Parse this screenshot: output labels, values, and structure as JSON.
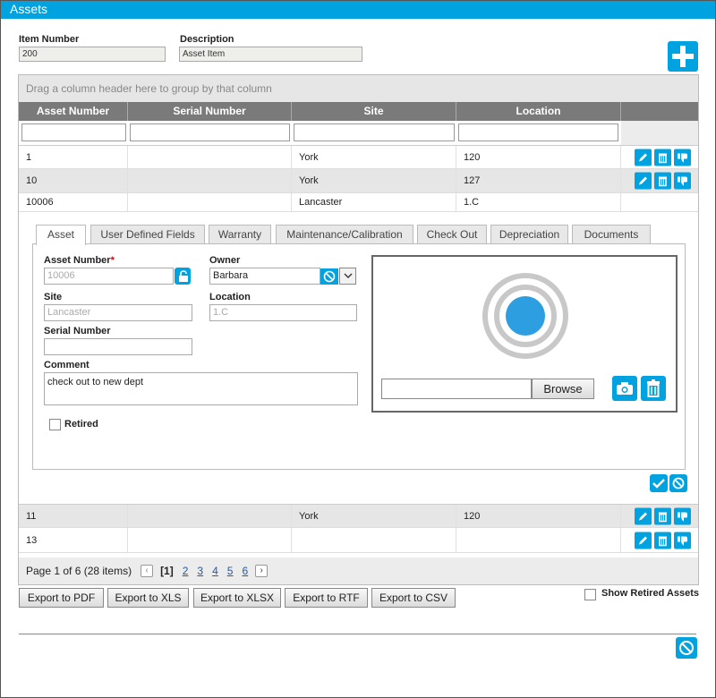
{
  "window": {
    "title": "Assets"
  },
  "item": {
    "item_number_label": "Item Number",
    "item_number_value": "200",
    "description_label": "Description",
    "description_value": "Asset Item"
  },
  "grid": {
    "group_hint": "Drag a column header here to group by that column",
    "columns": [
      "Asset Number",
      "Serial Number",
      "Site",
      "Location"
    ],
    "rows_top": [
      {
        "asset": "1",
        "serial": "",
        "site": "York",
        "location": "120"
      },
      {
        "asset": "10",
        "serial": "",
        "site": "York",
        "location": "127"
      },
      {
        "asset": "10006",
        "serial": "",
        "site": "Lancaster",
        "location": "1.C"
      }
    ],
    "rows_bottom": [
      {
        "asset": "11",
        "serial": "",
        "site": "York",
        "location": "120"
      },
      {
        "asset": "13",
        "serial": "",
        "site": "",
        "location": ""
      }
    ]
  },
  "tabs": [
    "Asset",
    "User Defined Fields",
    "Warranty",
    "Maintenance/Calibration",
    "Check Out",
    "Depreciation",
    "Documents"
  ],
  "form": {
    "asset_number_label": "Asset Number",
    "required_mark": "*",
    "asset_number_value": "10006",
    "owner_label": "Owner",
    "owner_value": "Barbara",
    "site_label": "Site",
    "site_value": "Lancaster",
    "location_label": "Location",
    "location_value": "1.C",
    "serial_label": "Serial Number",
    "serial_value": "",
    "comment_label": "Comment",
    "comment_value": "check out to new dept",
    "retired_label": "Retired",
    "browse_label": "Browse"
  },
  "pager": {
    "summary": "Page 1 of 6 (28 items)",
    "current": "[1]",
    "pages": [
      "2",
      "3",
      "4",
      "5",
      "6"
    ],
    "prev": "‹",
    "next": "›"
  },
  "export": [
    "Export to PDF",
    "Export to XLS",
    "Export to XLSX",
    "Export to RTF",
    "Export to CSV"
  ],
  "show_retired_label": "Show Retired Assets",
  "colors": {
    "accent": "#00a2e0",
    "header": "#7a7a7a",
    "alt_row": "#e6e6e6",
    "photo_dot": "#2d9fe0"
  }
}
